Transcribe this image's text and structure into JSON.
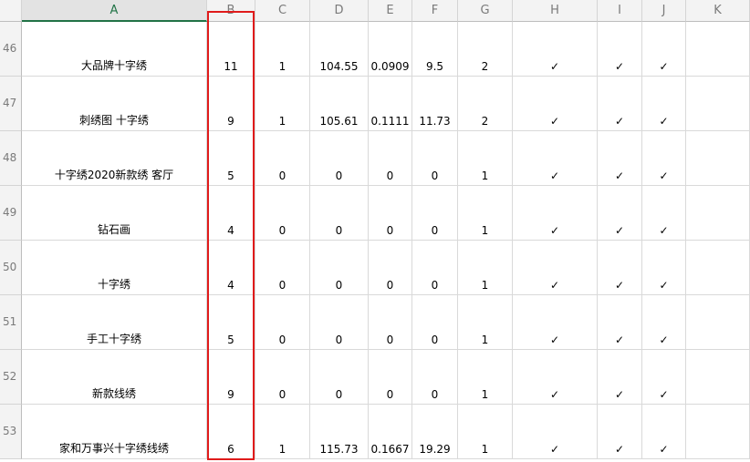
{
  "columns": [
    "A",
    "B",
    "C",
    "D",
    "E",
    "F",
    "G",
    "H",
    "I",
    "J",
    "K"
  ],
  "rows": [
    {
      "num": "46",
      "cells": [
        "大品牌十字绣",
        "11",
        "1",
        "104.55",
        "0.0909",
        "9.5",
        "2",
        "✓",
        "✓",
        "✓",
        ""
      ]
    },
    {
      "num": "47",
      "cells": [
        "刺绣图 十字绣",
        "9",
        "1",
        "105.61",
        "0.1111",
        "11.73",
        "2",
        "✓",
        "✓",
        "✓",
        ""
      ]
    },
    {
      "num": "48",
      "cells": [
        "十字绣2020新款绣 客厅",
        "5",
        "0",
        "0",
        "0",
        "0",
        "1",
        "✓",
        "✓",
        "✓",
        ""
      ]
    },
    {
      "num": "49",
      "cells": [
        "钻石画",
        "4",
        "0",
        "0",
        "0",
        "0",
        "1",
        "✓",
        "✓",
        "✓",
        ""
      ]
    },
    {
      "num": "50",
      "cells": [
        "十字绣",
        "4",
        "0",
        "0",
        "0",
        "0",
        "1",
        "✓",
        "✓",
        "✓",
        ""
      ]
    },
    {
      "num": "51",
      "cells": [
        "手工十字绣",
        "5",
        "0",
        "0",
        "0",
        "0",
        "1",
        "✓",
        "✓",
        "✓",
        ""
      ]
    },
    {
      "num": "52",
      "cells": [
        "新款线绣",
        "9",
        "0",
        "0",
        "0",
        "0",
        "1",
        "✓",
        "✓",
        "✓",
        ""
      ]
    },
    {
      "num": "53",
      "cells": [
        "家和万事兴十字绣线绣",
        "6",
        "1",
        "115.73",
        "0.1667",
        "19.29",
        "1",
        "✓",
        "✓",
        "✓",
        ""
      ]
    }
  ],
  "colors": {
    "header_bg": "#f3f3f3",
    "grid": "#d9d9d9",
    "highlight": "#e01b1b",
    "active_col": "#217346"
  }
}
